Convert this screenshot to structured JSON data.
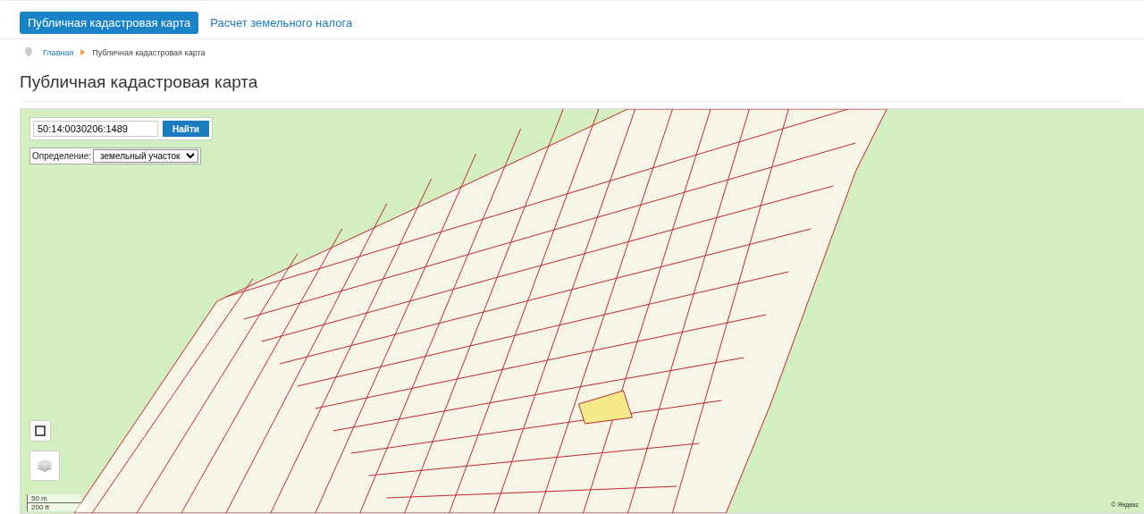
{
  "nav_tabs": [
    {
      "label": "Публичная кадастровая карта",
      "selected": true
    },
    {
      "label": "Расчет земельного налога",
      "selected": false
    }
  ],
  "breadcrumb": [
    {
      "label": "Главная"
    },
    {
      "label": "Публичная кадастровая карта"
    }
  ],
  "page_title": "Публичная кадастровая карта",
  "map": {
    "search": {
      "value": "50:14:0030206:1489",
      "button": "Найти"
    },
    "definition": {
      "label": "Определение:",
      "value": "земельный участок"
    },
    "scale": [
      "50 m",
      "200 ft"
    ],
    "attribution": "© Яндекс"
  }
}
